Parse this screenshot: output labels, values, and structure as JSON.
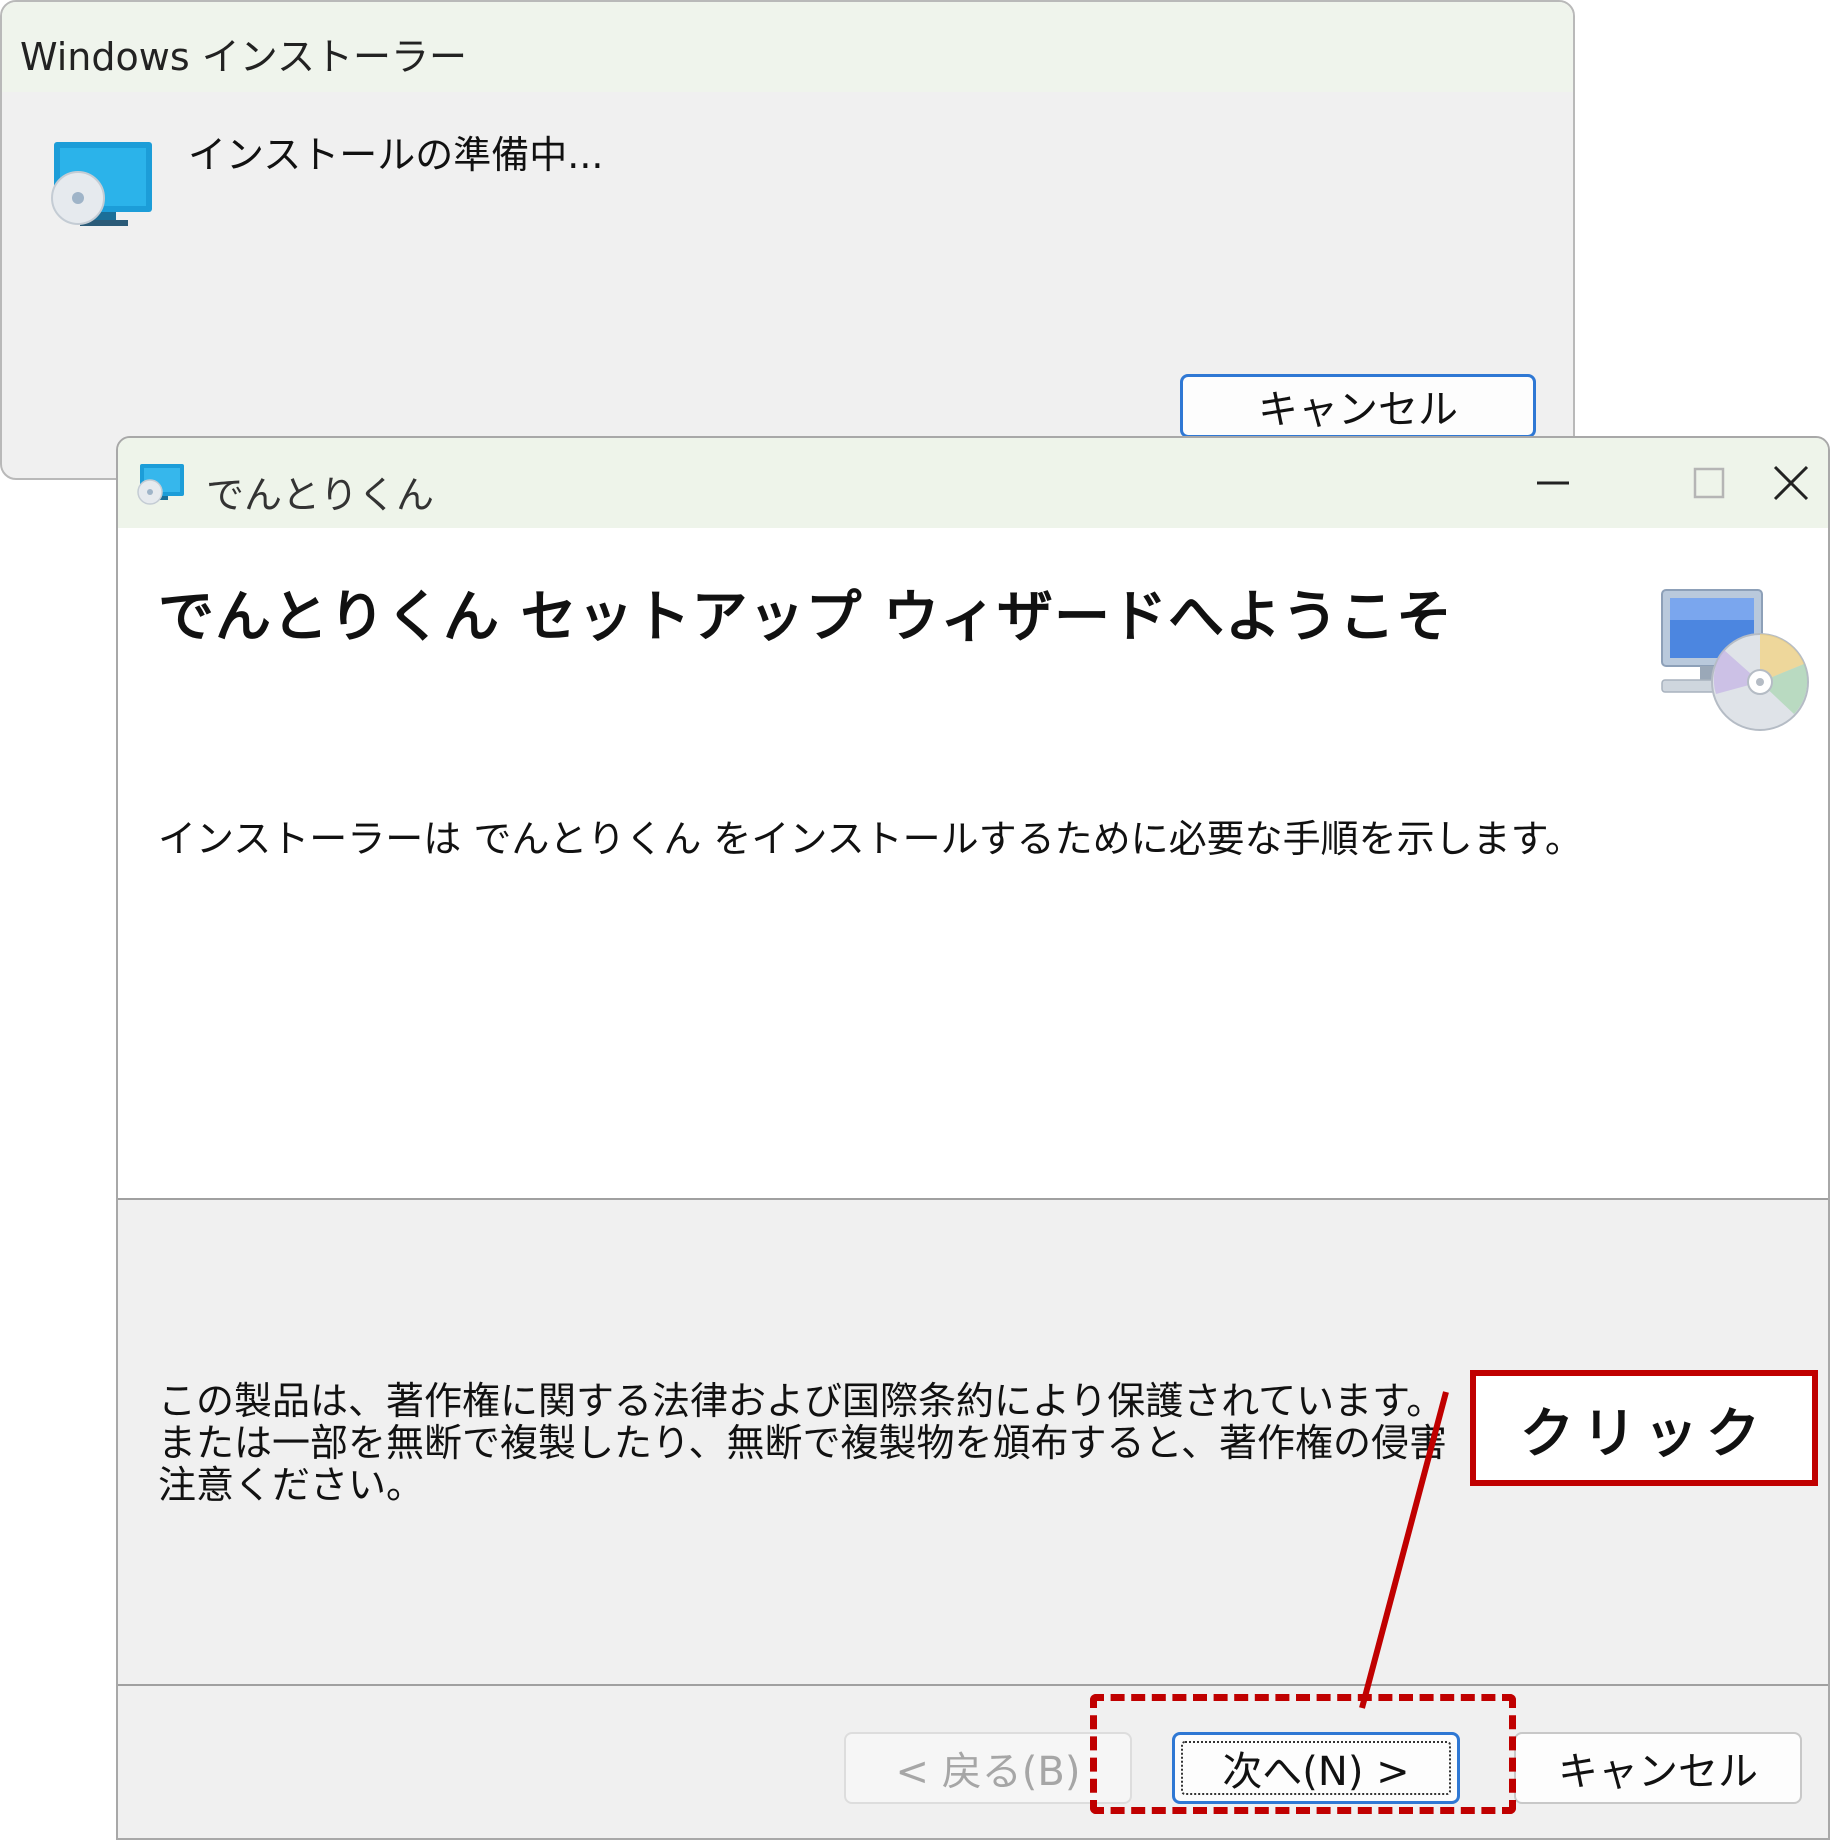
{
  "installer_window": {
    "title": "Windows インストーラー",
    "message": "インストールの準備中...",
    "cancel_label": "キャンセル",
    "icon": "installer-monitor-disc-icon"
  },
  "setup_window": {
    "title": "でんとりくん",
    "heading": "でんとりくん セットアップ ウィザードへようこそ",
    "intro": "インストーラーは でんとりくん をインストールするために必要な手順を示します。",
    "copyright_lines": [
      "この製品は、著作権に関する法律および国際条約により保護されています。",
      "または一部を無断で複製したり、無断で複製物を頒布すると、著作権の侵害",
      "注意ください。"
    ],
    "buttons": {
      "back": "< 戻る(B)",
      "next": "次へ(N) >",
      "cancel": "キャンセル"
    },
    "caption_buttons": [
      "minimize-icon",
      "maximize-icon",
      "close-icon"
    ]
  },
  "annotation": {
    "label": "クリック",
    "color": "#c00000"
  },
  "colors": {
    "focus_border": "#2f78d4",
    "titlebar_tint": "#eef4ea"
  }
}
